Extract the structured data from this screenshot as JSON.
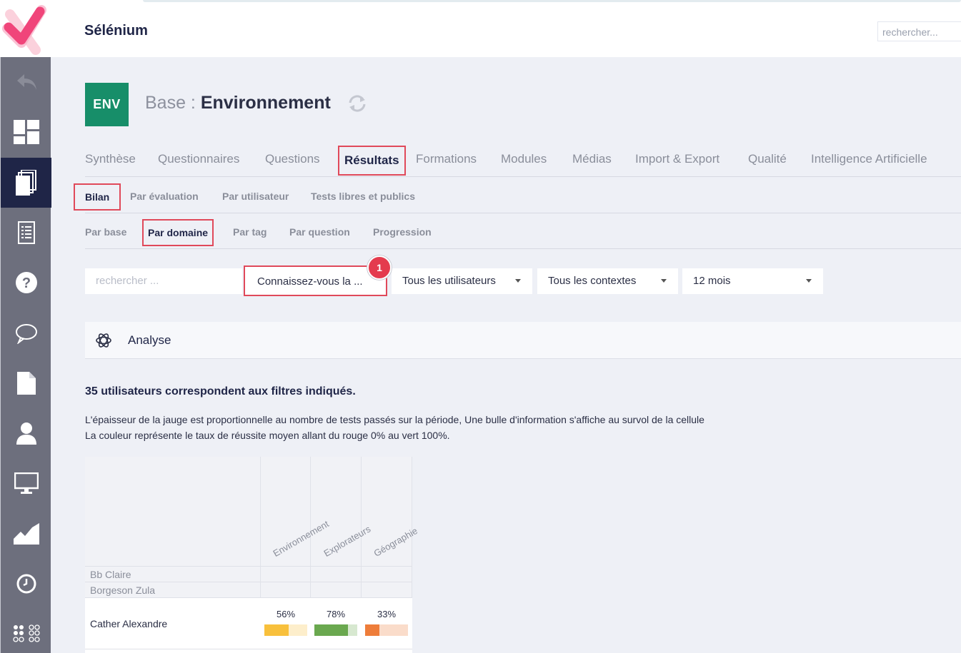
{
  "app": {
    "title": "Sélénium",
    "search_placeholder": "rechercher..."
  },
  "base": {
    "badge": "ENV",
    "prefix": "Base : ",
    "name": "Environnement"
  },
  "tabs": [
    "Synthèse",
    "Questionnaires",
    "Questions",
    "Résultats",
    "Formations",
    "Modules",
    "Médias",
    "Import & Export",
    "Qualité",
    "Intelligence Artificielle"
  ],
  "subtabs": [
    "Bilan",
    "Par évaluation",
    "Par utilisateur",
    "Tests libres et publics"
  ],
  "subtabs2": [
    "Par base",
    "Par domaine",
    "Par tag",
    "Par question",
    "Progression"
  ],
  "filters": {
    "search_placeholder": "rechercher ...",
    "questionnaire": "Connaissez-vous la ...",
    "users": "Tous les utilisateurs",
    "contexts": "Tous les contextes",
    "period": "12 mois"
  },
  "step_badge": "1",
  "analyse_label": "Analyse",
  "count_text": "35 utilisateurs correspondent aux filtres indiqués.",
  "desc_line1": "L'épaisseur de la jauge est proportionnelle au nombre de tests passés sur la période, Une bulle d'information s'affiche au survol de la cellule",
  "desc_line2": "La couleur représente le taux de réussite moyen allant du rouge 0% au vert 100%.",
  "grid": {
    "columns": [
      "Environnement",
      "Explorateurs",
      "Géographie"
    ],
    "rows": [
      {
        "name": "Bb Claire",
        "cells": []
      },
      {
        "name": "Borgeson Zula",
        "cells": []
      },
      {
        "name": "Cather Alexandre",
        "cells": [
          {
            "pct": "56%",
            "value": 0.56,
            "color": "#f8c03c"
          },
          {
            "pct": "78%",
            "value": 0.78,
            "color": "#6aa84f"
          },
          {
            "pct": "33%",
            "value": 0.33,
            "color": "#ee7d3a"
          }
        ]
      }
    ]
  },
  "colors": {
    "accent": "#e0495a",
    "brand": "#1f2547",
    "env_badge": "#178e69"
  }
}
